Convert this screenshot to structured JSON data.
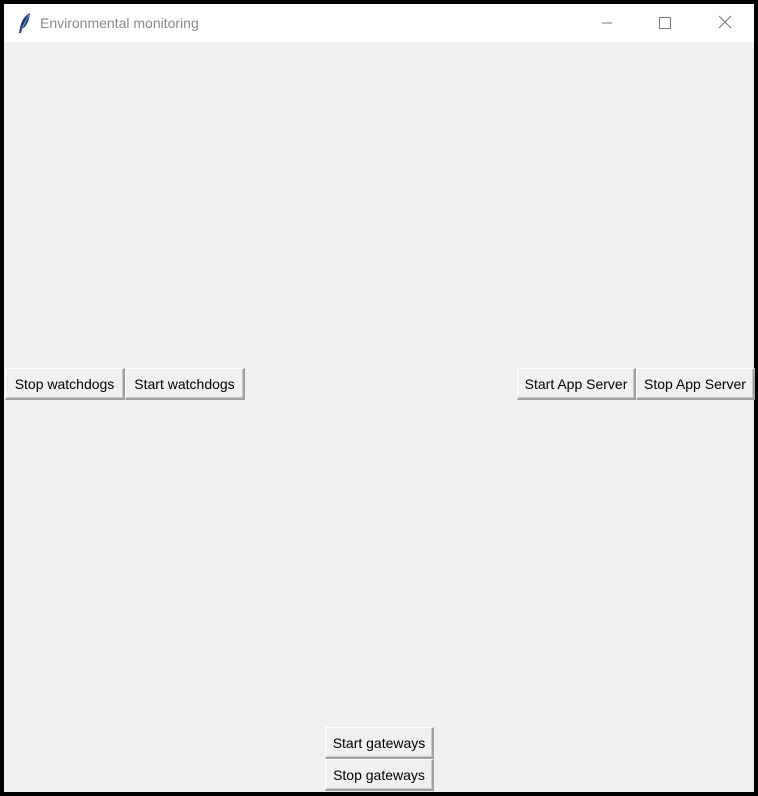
{
  "window": {
    "title": "Environmental monitoring",
    "icon": "feather-icon",
    "controls": {
      "minimize_icon": "minimize-icon",
      "maximize_icon": "maximize-icon",
      "close_icon": "close-icon"
    }
  },
  "watchdogs": {
    "stop_label": "Stop watchdogs",
    "start_label": "Start watchdogs"
  },
  "app_server": {
    "start_label": "Start App Server",
    "stop_label": "Stop App Server"
  },
  "gateways": {
    "start_label": "Start gateways",
    "stop_label": "Stop gateways"
  },
  "colors": {
    "background": "#f0f0f0",
    "titlebar": "#ffffff",
    "title_text": "#8a8a8a",
    "frame": "#000000"
  }
}
